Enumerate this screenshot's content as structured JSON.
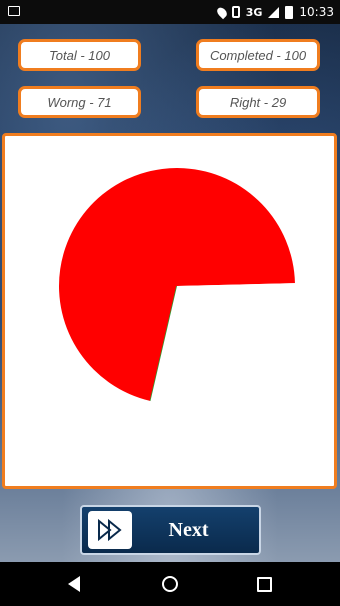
{
  "status_bar": {
    "network": "3G",
    "time": "10:33"
  },
  "stats": {
    "total": "Total - 100",
    "completed": "Completed - 100",
    "wrong": "Worng - 71",
    "right": "Right - 29"
  },
  "chart_data": {
    "type": "pie",
    "slices": [
      {
        "value": 71,
        "color": "#ff0000"
      },
      {
        "value": 29,
        "color": "#ffffff"
      }
    ],
    "accent_line_color": "#2e9b2e"
  },
  "next_button": {
    "label": "Next",
    "icon": "fast-forward-icon"
  },
  "colors": {
    "accent": "#f07d1f",
    "button": "#0e3459"
  }
}
